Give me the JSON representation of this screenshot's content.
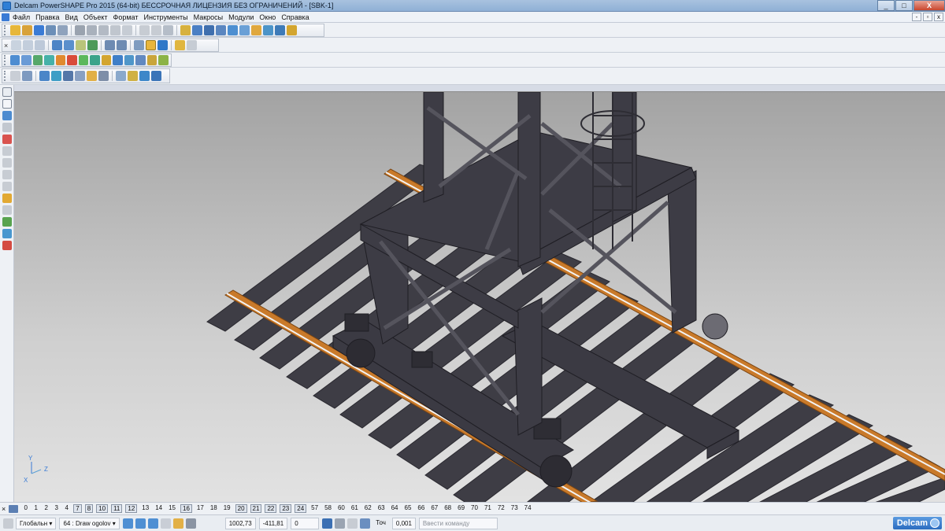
{
  "window": {
    "title": "Delcam PowerSHAPE Pro 2015 (64-bit) БЕССРОЧНАЯ ЛИЦЕНЗИЯ БЕЗ ОГРАНИЧЕНИЙ - [SBK-1]",
    "min_label": "_",
    "max_label": "□",
    "close_label": "X"
  },
  "menu": {
    "items": [
      "Файл",
      "Правка",
      "Вид",
      "Объект",
      "Формат",
      "Инструменты",
      "Макросы",
      "Модули",
      "Окно",
      "Справка"
    ],
    "mdi_min": "-",
    "mdi_restore": "▫",
    "mdi_close": "x"
  },
  "toolbars": {
    "close_glyph": "×",
    "accent_colors": [
      "#e7b73a",
      "#3a7bd5",
      "#4aa0d8",
      "#8a6bc1",
      "#d9534f",
      "#5cb85c",
      "#f0a94a",
      "#6c8fb8"
    ]
  },
  "layers": {
    "close_glyph": "×",
    "items": [
      "0",
      "1",
      "2",
      "3",
      "4",
      "7",
      "8",
      "10",
      "11",
      "12",
      "13",
      "14",
      "15",
      "16",
      "17",
      "18",
      "19",
      "20",
      "21",
      "22",
      "23",
      "24",
      "57",
      "58",
      "60",
      "61",
      "62",
      "63",
      "64",
      "65",
      "66",
      "67",
      "68",
      "69",
      "70",
      "71",
      "72",
      "73",
      "74"
    ],
    "boxed": [
      "7",
      "8",
      "10",
      "11",
      "12",
      "16",
      "20",
      "21",
      "22",
      "23",
      "24"
    ]
  },
  "status": {
    "workplane": "Глобальн ▾",
    "level": "64 : Draw ogolov ▾",
    "x": "1002,73",
    "y": "-411,81",
    "z": "0",
    "tol_label": "Точ",
    "tol_value": "0,001",
    "command_placeholder": "Ввести команду",
    "brand": "Delcam"
  },
  "axes": {
    "x": "X",
    "y": "Y",
    "z": "Z"
  }
}
